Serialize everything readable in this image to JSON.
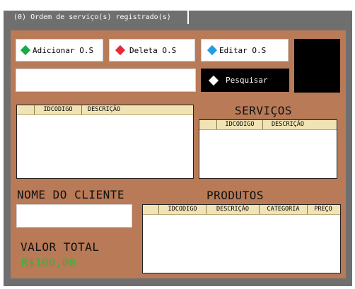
{
  "window": {
    "tab_title": "(0) Ordem de serviço(s) registrado(s)"
  },
  "toolbar": {
    "add_label": "Adicionar O.S",
    "delete_label": "Deleta O.S",
    "edit_label": "Editar O.S",
    "search_label": "Pesquisar"
  },
  "colors": {
    "add_icon": "#1aa84a",
    "delete_icon": "#e8283a",
    "edit_icon": "#1f9ee3",
    "accent_panel": "#b87a57"
  },
  "main_table": {
    "columns": [
      "",
      "IDCODIGO",
      "DESCRIÇÃO"
    ]
  },
  "services": {
    "title": "SERVIÇOS",
    "columns": [
      "",
      "IDCODIGO",
      "DESCRIÇÃO"
    ]
  },
  "client": {
    "title": "NOME DO CLIENTE"
  },
  "products": {
    "title": "PRODUTOS",
    "columns": [
      "",
      "IDCODIGO",
      "DESCRIÇÃO",
      "CATEGORIA",
      "PREÇO"
    ]
  },
  "total": {
    "title": "VALOR TOTAL",
    "value": "R$100,00"
  }
}
